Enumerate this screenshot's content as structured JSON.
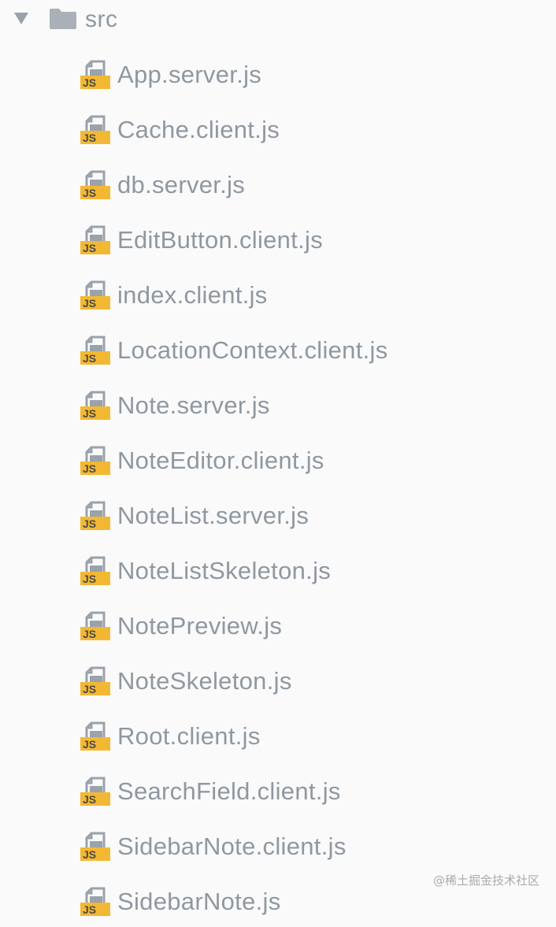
{
  "folder": {
    "name": "src",
    "expanded": true,
    "chevron_icon": "chevron-down-icon",
    "folder_icon": "folder-icon"
  },
  "files": [
    {
      "name": "App.server.js",
      "icon": "js-file-icon"
    },
    {
      "name": "Cache.client.js",
      "icon": "js-file-icon"
    },
    {
      "name": "db.server.js",
      "icon": "js-file-icon"
    },
    {
      "name": "EditButton.client.js",
      "icon": "js-file-icon"
    },
    {
      "name": "index.client.js",
      "icon": "js-file-icon"
    },
    {
      "name": "LocationContext.client.js",
      "icon": "js-file-icon"
    },
    {
      "name": "Note.server.js",
      "icon": "js-file-icon"
    },
    {
      "name": "NoteEditor.client.js",
      "icon": "js-file-icon"
    },
    {
      "name": "NoteList.server.js",
      "icon": "js-file-icon"
    },
    {
      "name": "NoteListSkeleton.js",
      "icon": "js-file-icon"
    },
    {
      "name": "NotePreview.js",
      "icon": "js-file-icon"
    },
    {
      "name": "NoteSkeleton.js",
      "icon": "js-file-icon"
    },
    {
      "name": "Root.client.js",
      "icon": "js-file-icon"
    },
    {
      "name": "SearchField.client.js",
      "icon": "js-file-icon"
    },
    {
      "name": "SidebarNote.client.js",
      "icon": "js-file-icon"
    },
    {
      "name": "SidebarNote.js",
      "icon": "js-file-icon"
    }
  ],
  "js_badge_text": "JS",
  "watermark": "@稀土掘金技术社区",
  "colors": {
    "background": "#fafafa",
    "text": "#8f98a1",
    "folder": "#a9b0b7",
    "js_badge": "#f3b833",
    "js_text": "#4a4a4a",
    "page_icon": "#9aa2ab"
  }
}
